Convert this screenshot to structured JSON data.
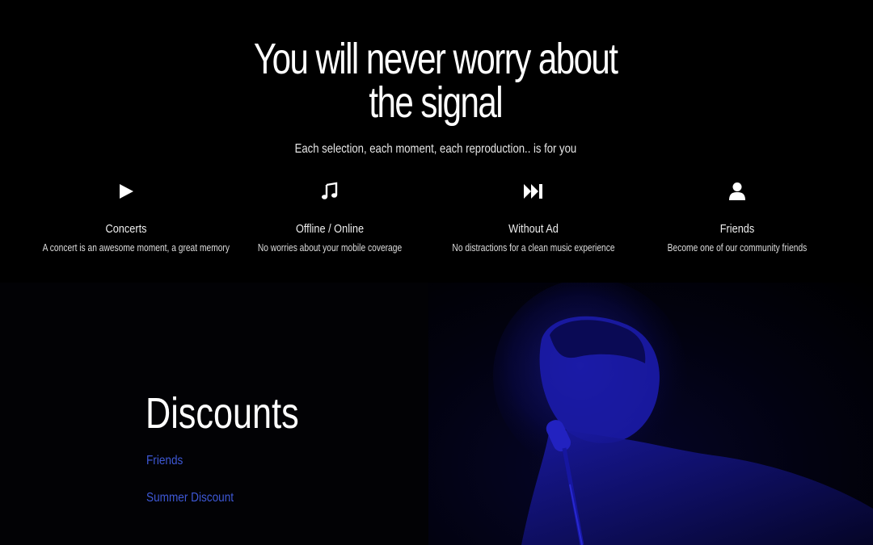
{
  "hero": {
    "headline_line1": "You will never worry about",
    "headline_line2": "the signal",
    "subheadline": "Each selection, each moment, each reproduction.. is for you"
  },
  "features": [
    {
      "icon": "play-icon",
      "title": "Concerts",
      "description": "A concert is an awesome moment, a great memory"
    },
    {
      "icon": "music-note-icon",
      "title": "Offline / Online",
      "description": "No worries about your mobile coverage"
    },
    {
      "icon": "skip-forward-icon",
      "title": "Without Ad",
      "description": "No distractions for a clean music experience"
    },
    {
      "icon": "user-icon",
      "title": "Friends",
      "description": "Become one of our community friends"
    }
  ],
  "discounts": {
    "title": "Discounts",
    "links": [
      "Friends",
      "Summer Discount"
    ]
  },
  "colors": {
    "background": "#000000",
    "link": "#3e58d6",
    "photo_tint": "#1a1ad6"
  }
}
